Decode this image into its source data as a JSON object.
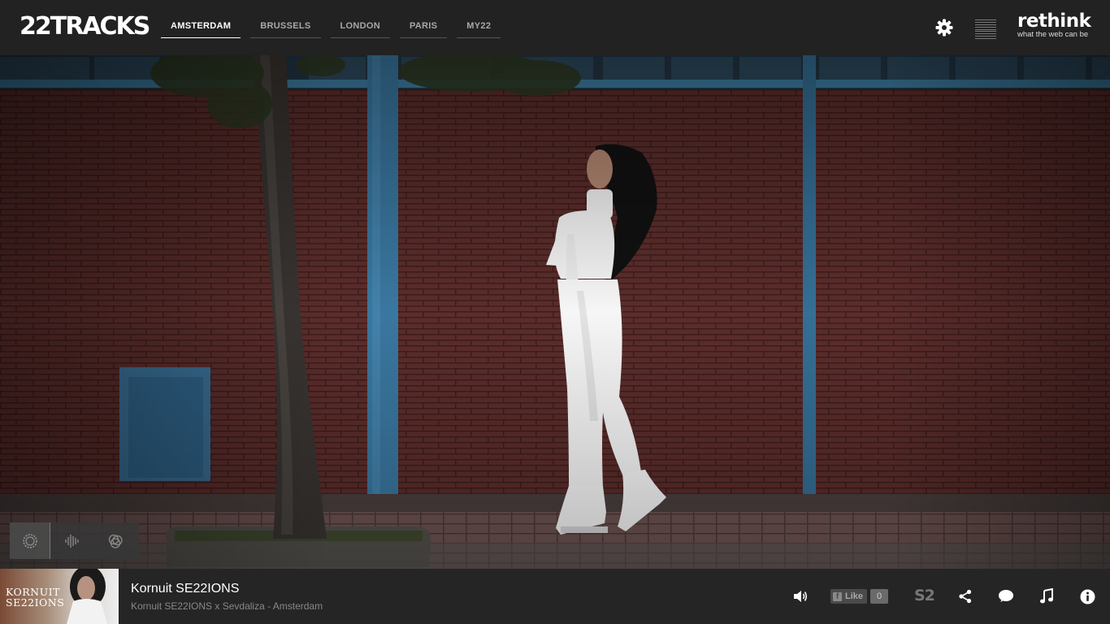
{
  "header": {
    "logo": "22TRACKS",
    "cities": [
      {
        "label": "AMSTERDAM",
        "active": true
      },
      {
        "label": "BRUSSELS",
        "active": false
      },
      {
        "label": "LONDON",
        "active": false
      },
      {
        "label": "PARIS",
        "active": false
      },
      {
        "label": "MY22",
        "active": false
      }
    ],
    "settings_icon": "gear-icon",
    "menu_icon": "hamburger-icon",
    "sponsor": {
      "word": "rethink",
      "tagline": "what the web can be"
    }
  },
  "hero": {
    "image": "artist-photo-woman-in-white-against-brick-wall"
  },
  "visualizer": {
    "icons": [
      "circle-visualizer-icon",
      "waveform-icon",
      "circles-visualizer-icon"
    ]
  },
  "player": {
    "cover": {
      "title_line1": "KORNUIT",
      "title_line2": "SE22IONS"
    },
    "track_title": "Kornuit SE22IONS",
    "track_subtitle": "Kornuit SE22IONS x Sevdaliza - Amsterdam",
    "controls": {
      "volume_icon": "volume-icon",
      "fb_like_label": "Like",
      "fb_like_count": "0",
      "s2_label": "S2",
      "share_icon": "share-icon",
      "comment_icon": "comment-icon",
      "music_icon": "music-note-icon",
      "info_icon": "info-icon"
    }
  },
  "colors": {
    "topbar": "#222222",
    "player_bar": "#252525",
    "brick": "#5a2c2a",
    "steel_blue": "#3f7fa3"
  }
}
